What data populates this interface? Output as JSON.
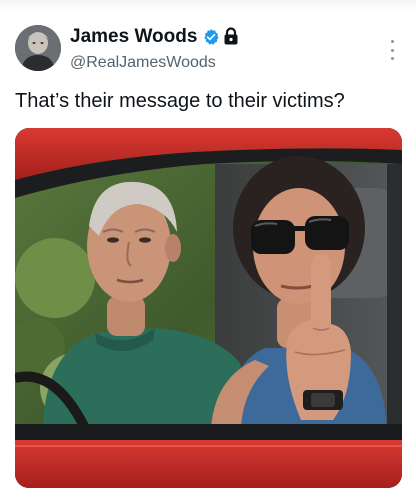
{
  "tweet": {
    "author": {
      "display_name": "James Woods",
      "handle": "@RealJamesWoods",
      "verified": true,
      "protected": true
    },
    "text": "That’s their message to their victims?",
    "media": {
      "type": "photo"
    }
  },
  "icons": {
    "avatar": "profile-photo",
    "verified": "verified-badge-icon",
    "lock": "lock-icon",
    "more": "more-options-icon"
  },
  "colors": {
    "verified_blue": "#1d9bf0",
    "name_text": "#0f1419",
    "secondary_text": "#536471",
    "car_red": "#c62a26"
  }
}
